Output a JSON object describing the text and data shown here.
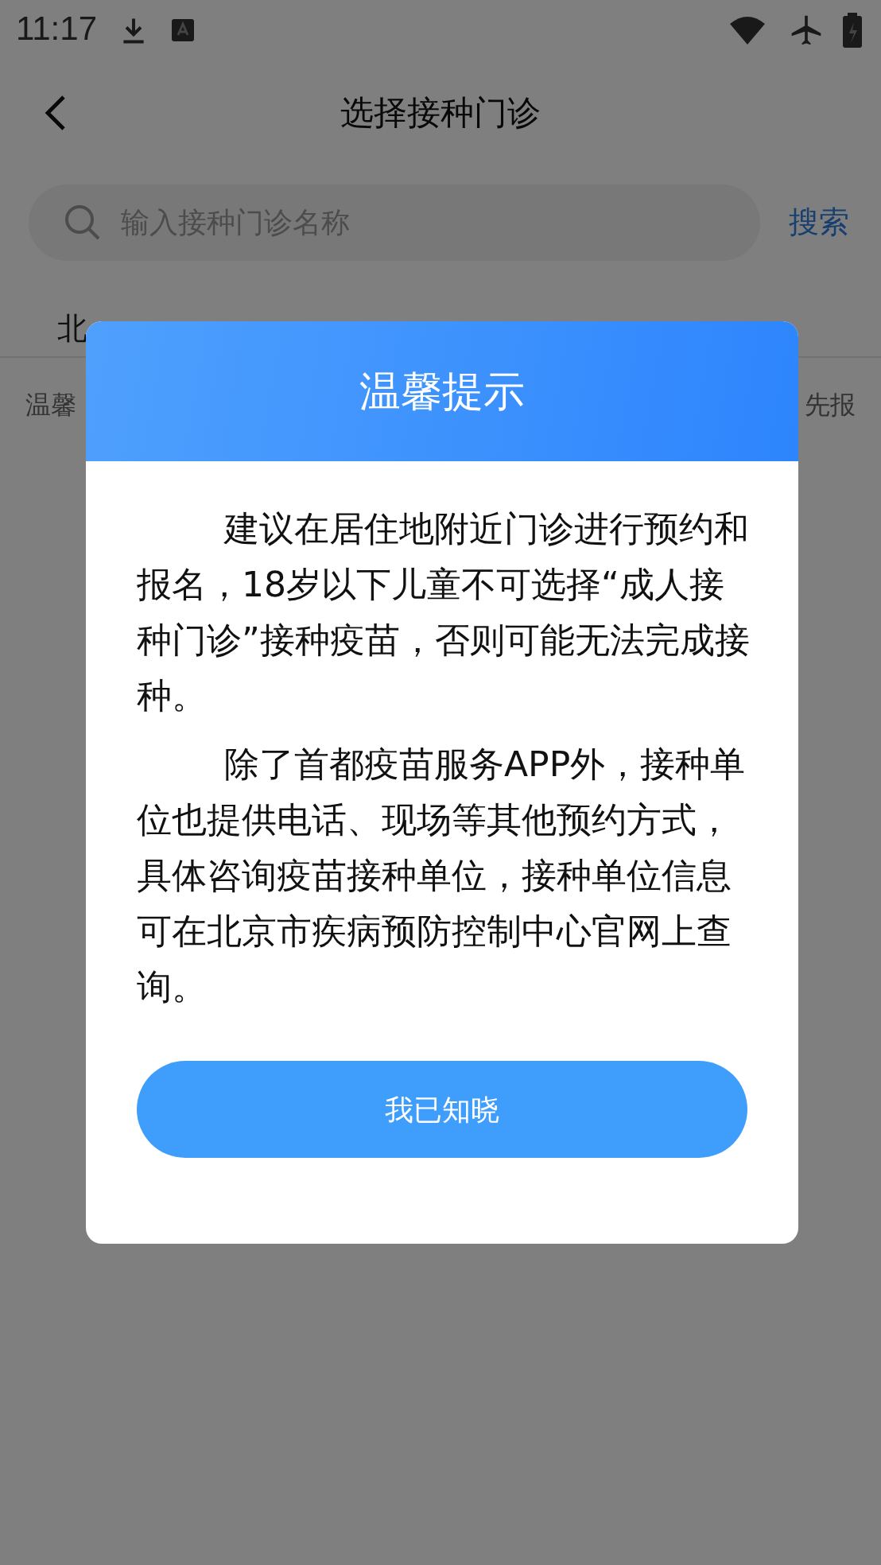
{
  "status_bar": {
    "time": "11:17"
  },
  "header": {
    "title": "选择接种门诊"
  },
  "search": {
    "placeholder": "输入接种门诊名称",
    "button": "搜索"
  },
  "filters": [
    {
      "label": "北"
    }
  ],
  "notice": {
    "left": "温馨",
    "right": "先报"
  },
  "dialog": {
    "title": "温馨提示",
    "paragraphs": [
      "建议在居住地附近门诊进行预约和报名，18岁以下儿童不可选择“成人接种门诊”接种疫苗，否则可能无法完成接种。",
      "除了首都疫苗服务APP外，接种单位也提供电话、现场等其他预约方式，具体咨询疫苗接种单位，接种单位信息可在北京市疾病预防控制中心官网上查询。"
    ],
    "button": "我已知晓"
  }
}
